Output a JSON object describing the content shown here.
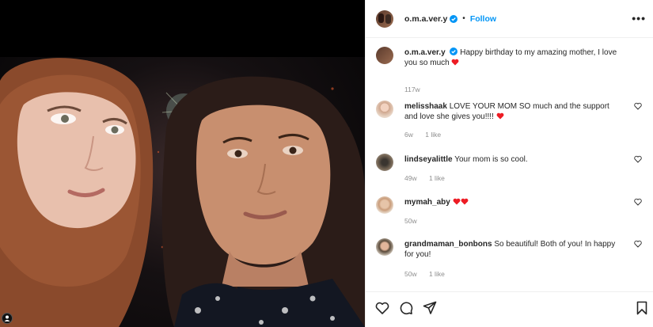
{
  "post": {
    "username": "o.m.a.ver.y",
    "follow_label": "Follow",
    "separator": "•",
    "more_label": "•••"
  },
  "caption": {
    "username": "o.m.a.ver.y",
    "text": "Happy birthday to my amazing mother, I love you so much",
    "time": "117w"
  },
  "comments": [
    {
      "username": "melisshaak",
      "text": "LOVE YOUR MOM SO much and the support and love she gives you!!!!",
      "time": "6w",
      "likes": "1 like",
      "hearts": 1
    },
    {
      "username": "lindseyalittle",
      "text": "Your mom is so cool.",
      "time": "49w",
      "likes": "1 like",
      "hearts": 0
    },
    {
      "username": "mymah_aby",
      "text": "",
      "time": "50w",
      "likes": "",
      "hearts": 2
    },
    {
      "username": "grandmaman_bonbons",
      "text": "So beautiful! Both of you! In happy for you!",
      "time": "50w",
      "likes": "1 like",
      "hearts": 0
    }
  ],
  "icons": [
    "heart-icon",
    "comment-icon",
    "share-icon",
    "bookmark-icon",
    "verified-icon",
    "tag-user-icon"
  ],
  "colors": {
    "follow": "#0095f6",
    "heart": "#ed1c24",
    "verified": "#0095f6",
    "meta": "#8e8e8e"
  }
}
